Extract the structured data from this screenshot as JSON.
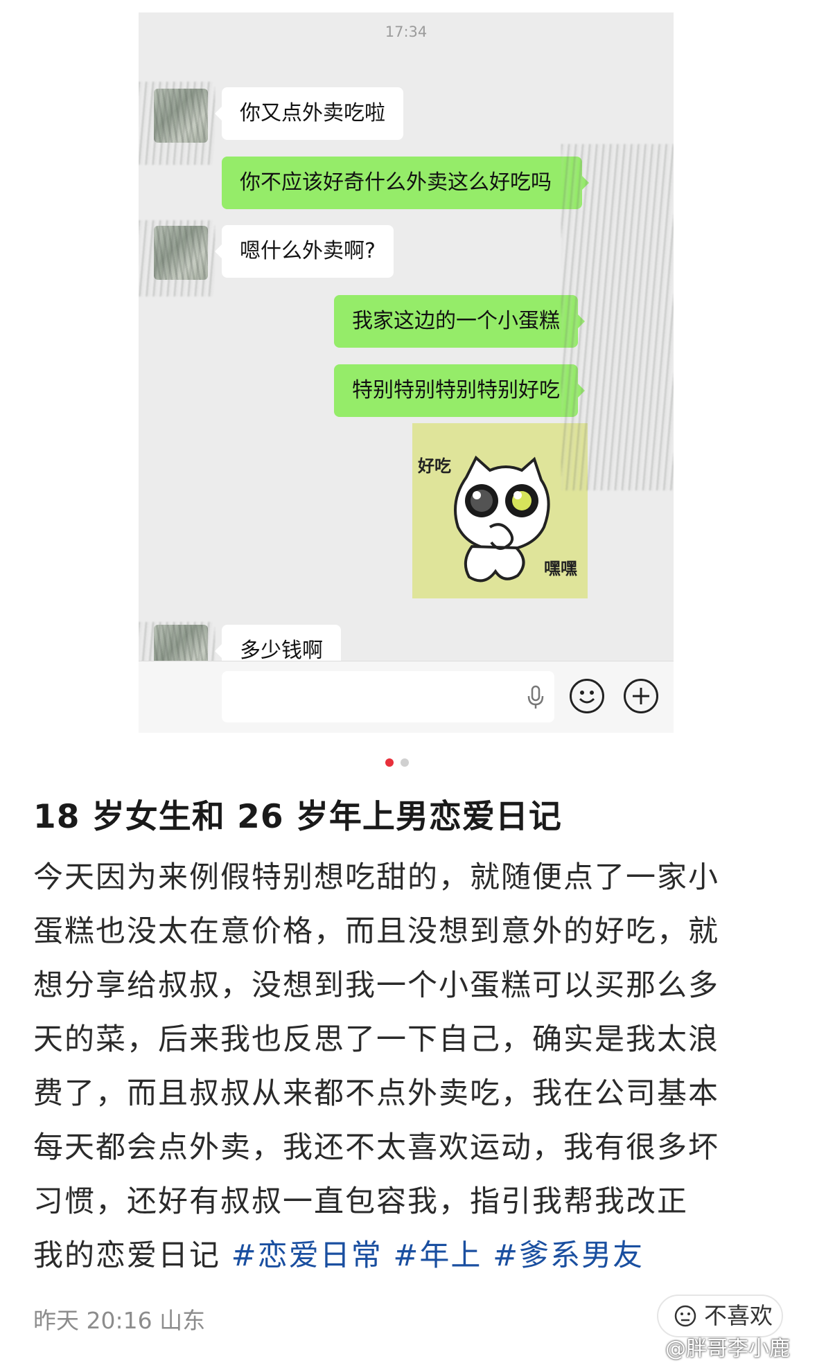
{
  "chat": {
    "time": "17:34",
    "messages": [
      {
        "side": "in",
        "text": "你又点外卖吃啦"
      },
      {
        "side": "out",
        "text": "你不应该好奇什么外卖这么好吃吗"
      },
      {
        "side": "in",
        "text": "嗯什么外卖啊?"
      },
      {
        "side": "out",
        "text": "我家这边的一个小蛋糕"
      },
      {
        "side": "out",
        "text": "特别特别特别特别好吃"
      },
      {
        "side": "in",
        "text": "多少钱啊"
      }
    ],
    "sticker": {
      "top_text": "好吃",
      "bottom_text": "嘿嘿"
    },
    "input_icons": [
      "microphone-icon",
      "emoji-icon",
      "plus-icon"
    ]
  },
  "carousel": {
    "count": 2,
    "active": 0,
    "active_color": "#e8303b",
    "inactive_color": "#d0d0d0"
  },
  "post": {
    "title": "18 岁女生和 26 岁年上男恋爱日记",
    "lines": [
      "今天因为来例假特别想吃甜的，就随便点了一家小",
      "蛋糕也没太在意价格，而且没想到意外的好吃，就",
      "想分享给叔叔，没想到我一个小蛋糕可以买那么多",
      "天的菜，后来我也反思了一下自己，确实是我太浪",
      "费了，而且叔叔从来都不点外卖吃，我在公司基本",
      "每天都会点外卖，我还不太喜欢运动，我有很多坏",
      "习惯，还好有叔叔一直包容我，指引我帮我改正"
    ],
    "last_line_text": "我的恋爱日记",
    "tags": [
      "#恋爱日常",
      "#年上",
      "#爹系男友"
    ],
    "tag_color": "#1a4fa0",
    "meta": "昨天 20:16 山东",
    "dislike_label": "不喜欢"
  },
  "watermark": "@胖哥李小鹿"
}
